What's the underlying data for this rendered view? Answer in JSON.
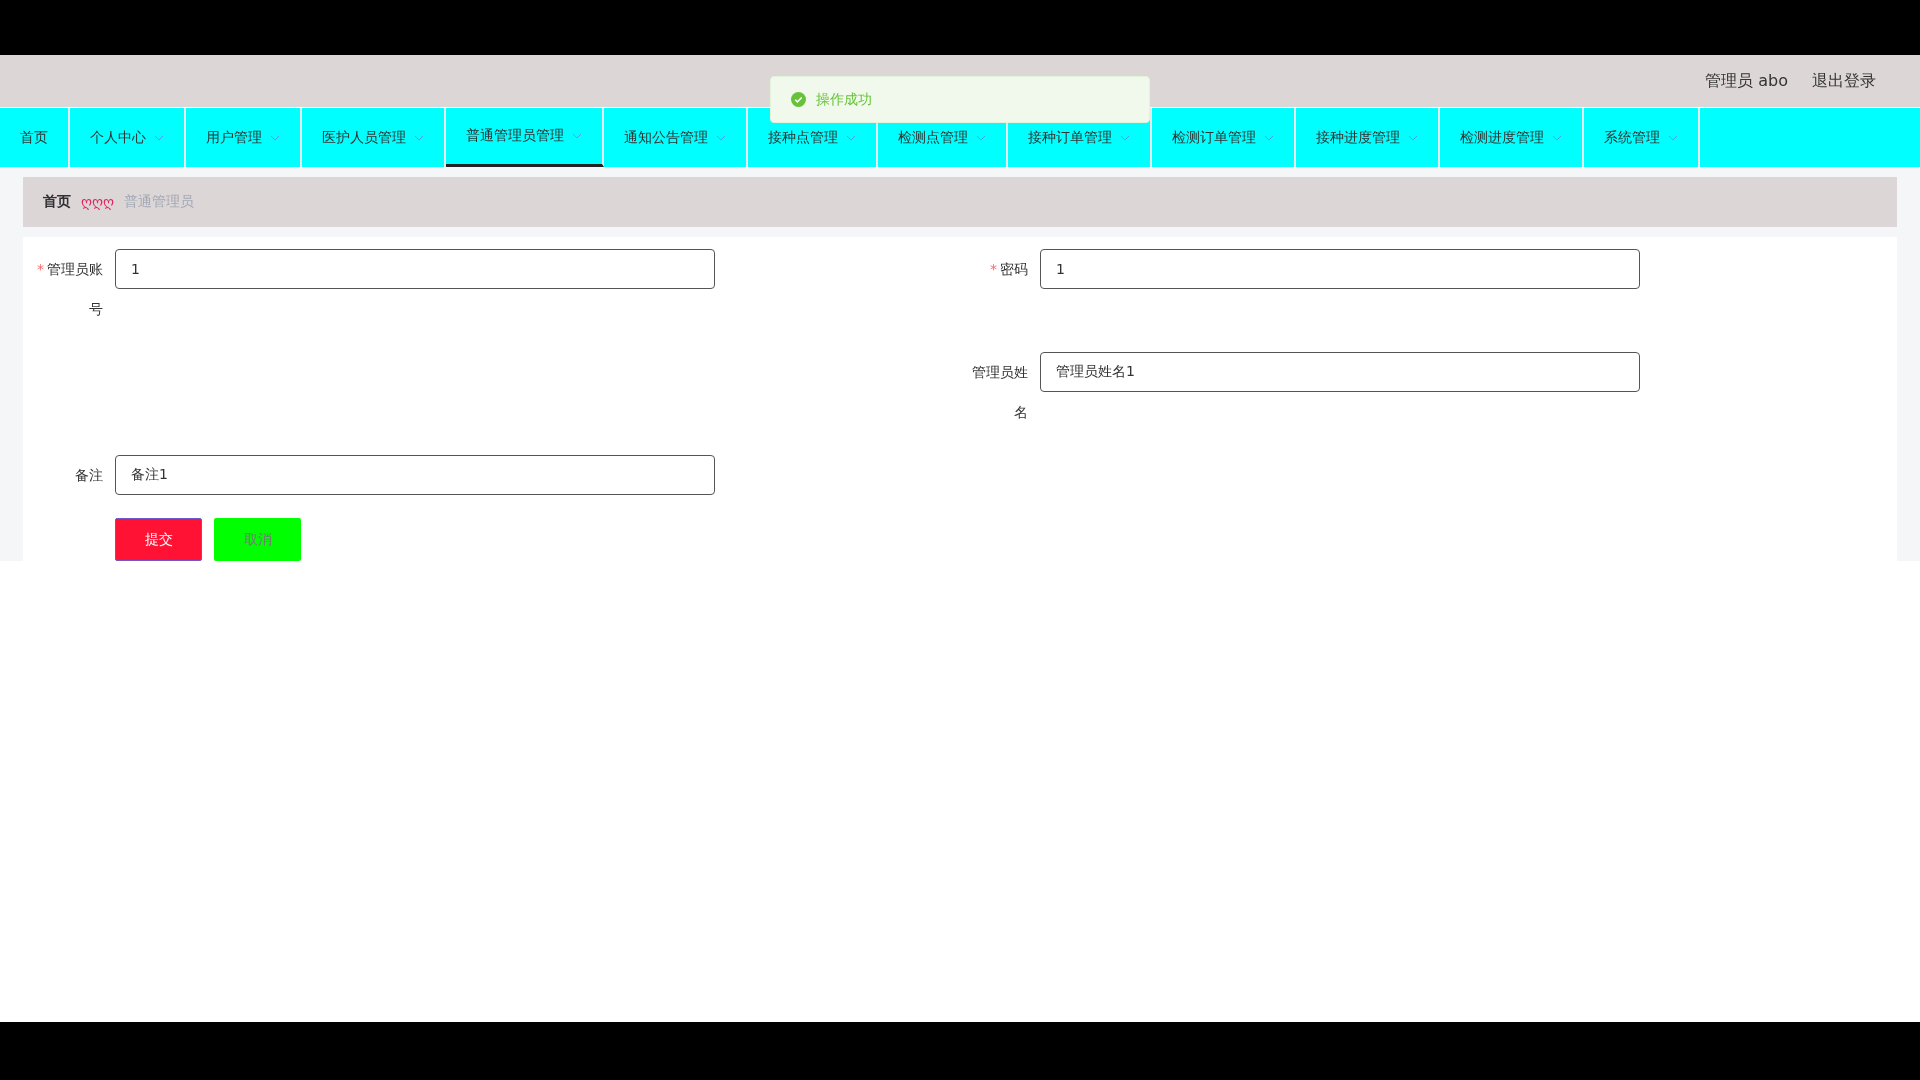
{
  "header": {
    "user": "管理员 abo",
    "logout": "退出登录"
  },
  "toast": {
    "message": "操作成功"
  },
  "nav": [
    {
      "label": "首页",
      "dropdown": false,
      "selected": false
    },
    {
      "label": "个人中心",
      "dropdown": true,
      "selected": false
    },
    {
      "label": "用户管理",
      "dropdown": true,
      "selected": false
    },
    {
      "label": "医护人员管理",
      "dropdown": true,
      "selected": false
    },
    {
      "label": "普通管理员管理",
      "dropdown": true,
      "selected": true
    },
    {
      "label": "通知公告管理",
      "dropdown": true,
      "selected": false
    },
    {
      "label": "接种点管理",
      "dropdown": true,
      "selected": false
    },
    {
      "label": "检测点管理",
      "dropdown": true,
      "selected": false
    },
    {
      "label": "接种订单管理",
      "dropdown": true,
      "selected": false
    },
    {
      "label": "检测订单管理",
      "dropdown": true,
      "selected": false
    },
    {
      "label": "接种进度管理",
      "dropdown": true,
      "selected": false
    },
    {
      "label": "检测进度管理",
      "dropdown": true,
      "selected": false
    },
    {
      "label": "系统管理",
      "dropdown": true,
      "selected": false
    }
  ],
  "breadcrumb": {
    "home": "首页",
    "separator": "ღღღ",
    "current": "普通管理员"
  },
  "form": {
    "rows": [
      [
        {
          "mark": "*",
          "label": "管理员账号",
          "value": "1"
        },
        {
          "mark": "*",
          "label": "密码",
          "value": "1"
        }
      ],
      [
        "",
        {
          "label": "管理员姓名",
          "value": "管理员姓名1"
        }
      ],
      [
        {
          "label": "备注",
          "value": "备注1"
        }
      ]
    ],
    "submit": "提交",
    "cancel": "取消"
  }
}
